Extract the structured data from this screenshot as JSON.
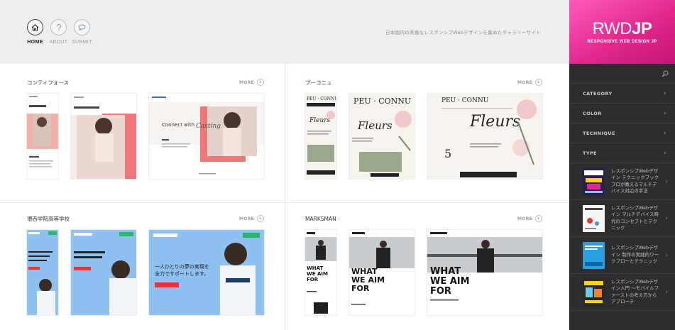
{
  "header": {
    "nav": [
      {
        "label": "HOME",
        "icon": "home-icon",
        "active": true
      },
      {
        "label": "ABOUT",
        "icon": "question-icon",
        "active": false
      },
      {
        "label": "SUBMIT",
        "icon": "chat-bubble-icon",
        "active": false
      }
    ],
    "tagline": "日本国内の秀逸なレスポンシブWebデザインを集めたギャラリーサイト"
  },
  "logo": {
    "title_light": "RWD",
    "title_bold": "JP",
    "subtitle": "RESPONSIVE WEB DESIGN JP"
  },
  "sidebar": {
    "menu": [
      {
        "label": "CATEGORY"
      },
      {
        "label": "COLOR"
      },
      {
        "label": "TECHNIQUE"
      },
      {
        "label": "TYPE"
      }
    ],
    "books": [
      {
        "title": "レスポンシブWebデザイン テクニックブック プロが教えるマルチデバイス対応の手法"
      },
      {
        "title": "レスポンシブWebデザイン マルチデバイス時代のコンセプトとテクニック"
      },
      {
        "title": "レスポンシブWebデザイン 制作の実践的ワークフローとテクニック"
      },
      {
        "title": "レスポンシブWebデザイン入門 ～モバイルファーストの考え方からアプローチ"
      }
    ]
  },
  "cards": [
    {
      "title": "コンティフォース",
      "more": "MORE",
      "site_text": "Connect with",
      "site_script": "Casting"
    },
    {
      "title": "プーコニュ",
      "more": "MORE",
      "site_brand": "PEU · CONNU",
      "site_script": "Fleurs"
    },
    {
      "title": "猥西学院高等学校",
      "more": "MORE",
      "site_text": "一人ひとりの夢の実現を全力でサポートします。"
    },
    {
      "title": "MARKSMAN",
      "more": "MORE",
      "site_text": "WHAT WE AIM FOR"
    }
  ],
  "colors": {
    "accent": "#e2288f",
    "sidebar_bg": "#2b2d2f",
    "coral": "#ee7878",
    "blue": "#6ea8e8"
  }
}
